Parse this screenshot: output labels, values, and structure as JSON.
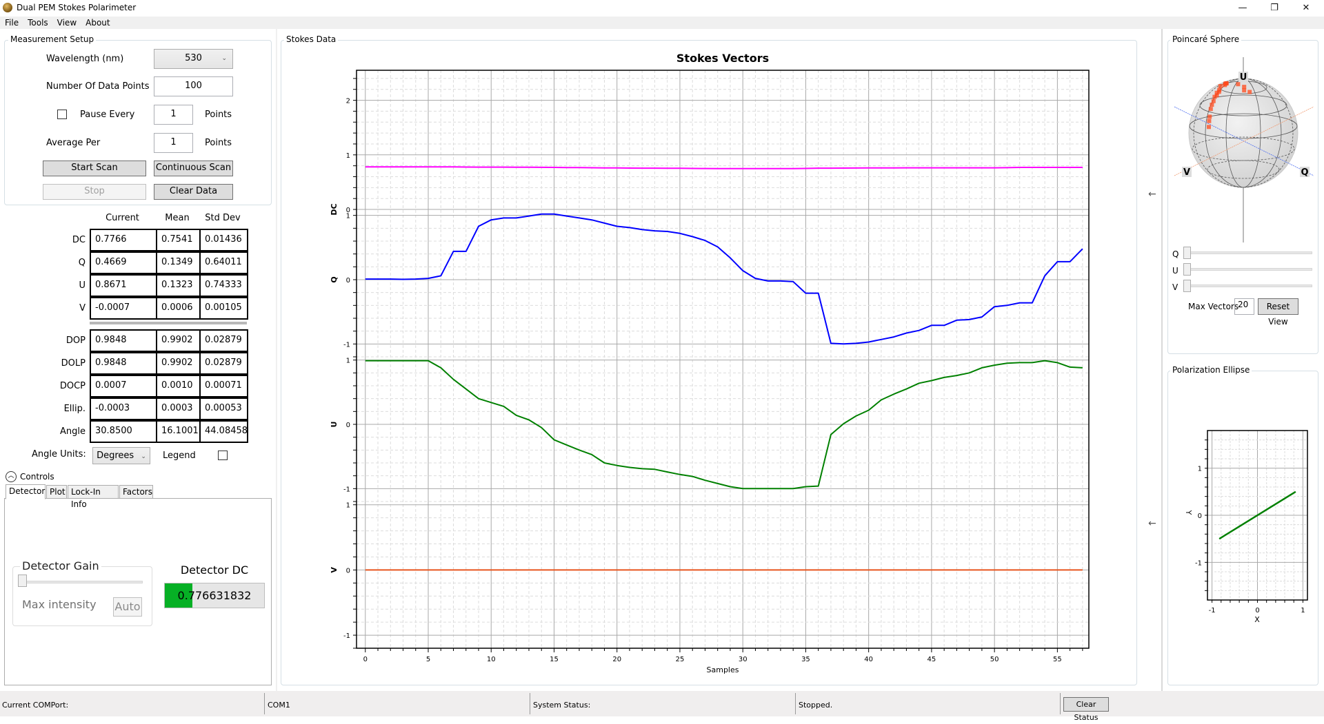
{
  "window": {
    "title": "Dual PEM Stokes Polarimeter",
    "controls": {
      "minimize": "—",
      "restore": "❐",
      "close": "✕"
    }
  },
  "menu": [
    "File",
    "Tools",
    "View",
    "About"
  ],
  "measurement_setup": {
    "title": "Measurement Setup",
    "wavelength_label": "Wavelength (nm)",
    "wavelength_value": "530",
    "data_points_label": "Number Of Data Points",
    "data_points_value": "100",
    "pause_every_label": "Pause Every",
    "pause_every_checked": false,
    "pause_every_value": "1",
    "pause_every_unit": "Points",
    "average_per_label": "Average Per",
    "average_per_value": "1",
    "average_per_unit": "Points",
    "start_scan": "Start Scan",
    "continuous_scan": "Continuous Scan",
    "stop": "Stop",
    "clear_data": "Clear Data"
  },
  "stats": {
    "columns": [
      "Current",
      "Mean",
      "Std Dev"
    ],
    "stokes_rows": [
      {
        "label": "DC",
        "values": [
          "0.7766",
          "0.7541",
          "0.01436"
        ]
      },
      {
        "label": "Q",
        "values": [
          "0.4669",
          "0.1349",
          "0.64011"
        ]
      },
      {
        "label": "U",
        "values": [
          "0.8671",
          "0.1323",
          "0.74333"
        ]
      },
      {
        "label": "V",
        "values": [
          "-0.0007",
          "0.0006",
          "0.00105"
        ]
      }
    ],
    "derived_rows": [
      {
        "label": "DOP",
        "values": [
          "0.9848",
          "0.9902",
          "0.02879"
        ]
      },
      {
        "label": "DOLP",
        "values": [
          "0.9848",
          "0.9902",
          "0.02879"
        ]
      },
      {
        "label": "DOCP",
        "values": [
          "0.0007",
          "0.0010",
          "0.00071"
        ]
      },
      {
        "label": "Ellip.",
        "values": [
          "-0.0003",
          "0.0003",
          "0.00053"
        ]
      },
      {
        "label": "Angle",
        "values": [
          "30.8500",
          "16.1001",
          "44.08458"
        ]
      }
    ],
    "angle_units_label": "Angle Units:",
    "angle_units_value": "Degrees",
    "legend_label": "Legend",
    "legend_checked": false
  },
  "controls": {
    "title": "Controls",
    "tabs": [
      "Detector",
      "Plot",
      "Lock-In Info",
      "Factors"
    ],
    "active_tab": "Detector",
    "detector_gain_title": "Detector Gain",
    "detector_gain_slider": 0,
    "max_intensity_label": "Max intensity",
    "auto_button": "Auto",
    "detector_dc_title": "Detector DC",
    "detector_dc_value": "0.776631832",
    "detector_dc_fraction": 0.28,
    "detector_dc_bar_color": "#06b025"
  },
  "stokes_data_group": {
    "title": "Stokes Data"
  },
  "chart_data": [
    {
      "type": "line",
      "title": "Stokes Vectors",
      "xlabel": "Samples",
      "x_range": [
        -0.7,
        57.5
      ],
      "x_ticks": [
        0,
        5,
        10,
        15,
        20,
        25,
        30,
        35,
        40,
        45,
        50,
        55
      ],
      "grid": true,
      "legend": "none",
      "x": [
        0,
        1,
        2,
        3,
        4,
        5,
        6,
        7,
        8,
        9,
        10,
        11,
        12,
        13,
        14,
        15,
        16,
        17,
        18,
        19,
        20,
        21,
        22,
        23,
        24,
        25,
        26,
        27,
        28,
        29,
        30,
        31,
        32,
        33,
        34,
        35,
        36,
        37,
        38,
        39,
        40,
        41,
        42,
        43,
        44,
        45,
        46,
        47,
        48,
        49,
        50,
        51,
        52,
        53,
        54,
        55,
        56,
        57
      ],
      "series": [
        {
          "name": "DC",
          "ylabel": "DC",
          "color": "#ff00ff",
          "ylim": [
            -0.05,
            2.55
          ],
          "y_ticks": [
            0,
            1,
            2
          ],
          "values": [
            0.78,
            0.78,
            0.78,
            0.78,
            0.78,
            0.78,
            0.78,
            0.78,
            0.777,
            0.775,
            0.775,
            0.775,
            0.774,
            0.773,
            0.772,
            0.77,
            0.768,
            0.766,
            0.764,
            0.762,
            0.76,
            0.758,
            0.757,
            0.756,
            0.755,
            0.754,
            0.752,
            0.75,
            0.749,
            0.748,
            0.748,
            0.748,
            0.748,
            0.748,
            0.748,
            0.752,
            0.756,
            0.757,
            0.758,
            0.759,
            0.76,
            0.761,
            0.762,
            0.763,
            0.763,
            0.763,
            0.763,
            0.763,
            0.763,
            0.763,
            0.763,
            0.765,
            0.77,
            0.77,
            0.77,
            0.77,
            0.77,
            0.77
          ]
        },
        {
          "name": "Q",
          "ylabel": "Q",
          "color": "#0000ff",
          "ylim": [
            -1.2,
            1.05
          ],
          "y_ticks": [
            -1,
            0,
            1
          ],
          "values": [
            0.01,
            0.01,
            0.01,
            0.005,
            0.01,
            0.02,
            0.06,
            0.44,
            0.44,
            0.83,
            0.93,
            0.96,
            0.96,
            0.99,
            1.02,
            1.02,
            0.99,
            0.96,
            0.93,
            0.88,
            0.83,
            0.81,
            0.78,
            0.76,
            0.75,
            0.72,
            0.67,
            0.61,
            0.51,
            0.34,
            0.14,
            0.02,
            -0.02,
            -0.02,
            -0.03,
            -0.21,
            -0.21,
            -0.99,
            -1.0,
            -0.99,
            -0.97,
            -0.93,
            -0.89,
            -0.83,
            -0.79,
            -0.71,
            -0.71,
            -0.63,
            -0.62,
            -0.58,
            -0.42,
            -0.4,
            -0.36,
            -0.36,
            0.06,
            0.28,
            0.28,
            0.48
          ]
        },
        {
          "name": "U",
          "ylabel": "U",
          "color": "#008000",
          "ylim": [
            -1.2,
            1.05
          ],
          "y_ticks": [
            -1,
            0,
            1
          ],
          "values": [
            0.99,
            0.99,
            0.99,
            0.99,
            0.99,
            0.99,
            0.88,
            0.7,
            0.55,
            0.4,
            0.34,
            0.28,
            0.14,
            0.07,
            -0.05,
            -0.24,
            -0.32,
            -0.4,
            -0.47,
            -0.6,
            -0.64,
            -0.67,
            -0.69,
            -0.7,
            -0.74,
            -0.78,
            -0.81,
            -0.87,
            -0.92,
            -0.97,
            -1.0,
            -1.0,
            -1.0,
            -1.0,
            -1.0,
            -0.97,
            -0.96,
            -0.16,
            0.01,
            0.13,
            0.22,
            0.38,
            0.47,
            0.55,
            0.64,
            0.68,
            0.73,
            0.76,
            0.8,
            0.88,
            0.92,
            0.95,
            0.96,
            0.96,
            0.99,
            0.96,
            0.89,
            0.88
          ]
        },
        {
          "name": "V",
          "ylabel": "V",
          "color": "#e8541c",
          "ylim": [
            -1.2,
            1.05
          ],
          "y_ticks": [
            -1,
            0,
            1
          ],
          "values": [
            0,
            0,
            0,
            0,
            0,
            0,
            0,
            0,
            0,
            0,
            0,
            0,
            0,
            0,
            0,
            0,
            0,
            0,
            0,
            0,
            0,
            0,
            0,
            0,
            0,
            0,
            0,
            0,
            0,
            0,
            0,
            0,
            0,
            0,
            0,
            0,
            0,
            0,
            0,
            0,
            0,
            0,
            0,
            0,
            0,
            0,
            0,
            0,
            0,
            0,
            0,
            0,
            0,
            0,
            0,
            0,
            0,
            0
          ]
        }
      ]
    },
    {
      "type": "line",
      "title": "Polarization Ellipse",
      "xlabel": "X",
      "ylabel": "Y",
      "x_range": [
        -1.1,
        1.1
      ],
      "ylim": [
        -1.8,
        1.8
      ],
      "x_ticks": [
        -1,
        0,
        1
      ],
      "y_ticks": [
        -1,
        0,
        1
      ],
      "grid": true,
      "series": [
        {
          "name": "ellipse",
          "color": "#008000",
          "x": [
            -0.84,
            0.84
          ],
          "y": [
            -0.5,
            0.5
          ]
        }
      ]
    }
  ],
  "poincare": {
    "title": "Poincaré Sphere",
    "axis_labels": {
      "u": "U",
      "v": "V",
      "q": "Q"
    },
    "sliders": [
      {
        "label": "Q",
        "value": 0
      },
      {
        "label": "U",
        "value": 0
      },
      {
        "label": "V",
        "value": 0
      }
    ],
    "max_vectors_label": "Max Vectors",
    "max_vectors_value": "20",
    "reset_view": "Reset View",
    "point_color": "#ff4a1c"
  },
  "collapse_arrows": [
    "←",
    "←"
  ],
  "status_bar": {
    "com_label": "Current COMPort:",
    "com_value": "COM1",
    "system_label": "System Status:",
    "system_value": "Stopped.",
    "clear_button": "Clear Status"
  }
}
